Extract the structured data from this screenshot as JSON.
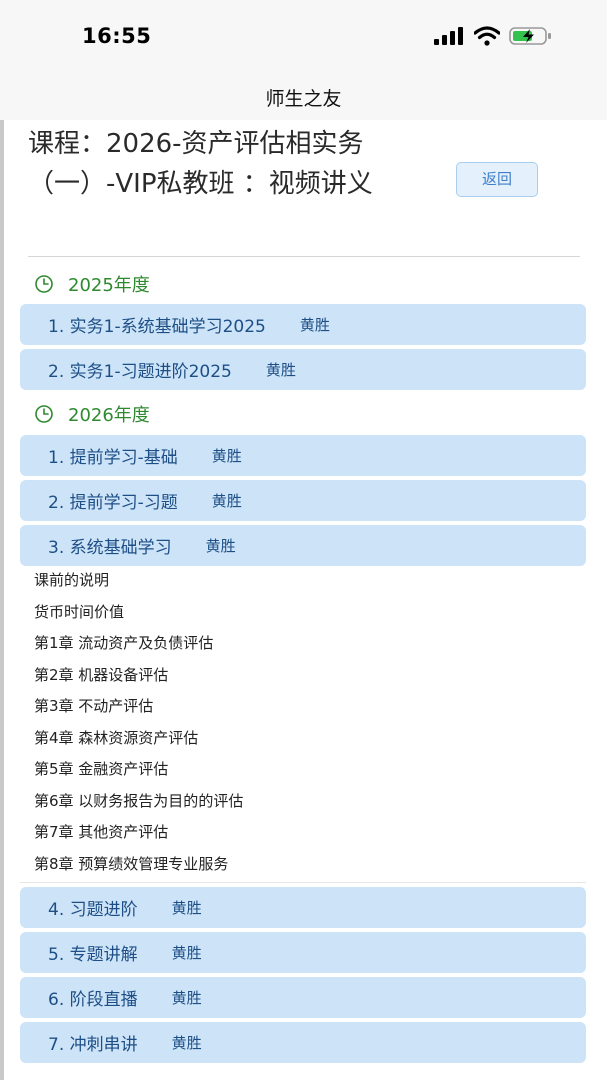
{
  "status_bar": {
    "time": "16:55",
    "battery": "charging"
  },
  "nav": {
    "title": "师生之友"
  },
  "course": {
    "title": "课程：2026-资产评估相实务（一）-VIP私教班 ：视频讲义",
    "back_label": "返回"
  },
  "years": [
    {
      "label": "2025年度",
      "sections": [
        {
          "title": "1. 实务1-系统基础学习2025",
          "teacher": "黄胜"
        },
        {
          "title": "2. 实务1-习题进阶2025",
          "teacher": "黄胜"
        }
      ]
    },
    {
      "label": "2026年度",
      "sections": [
        {
          "title": "1. 提前学习-基础",
          "teacher": "黄胜"
        },
        {
          "title": "2. 提前学习-习题",
          "teacher": "黄胜"
        },
        {
          "title": "3. 系统基础学习",
          "teacher": "黄胜",
          "lessons": [
            "课前的说明",
            "货币时间价值",
            "第1章 流动资产及负债评估",
            "第2章 机器设备评估",
            "第3章 不动产评估",
            "第4章 森林资源资产评估",
            "第5章 金融资产评估",
            "第6章 以财务报告为目的的评估",
            "第7章 其他资产评估",
            "第8章 预算绩效管理专业服务"
          ]
        },
        {
          "title": "4. 习题进阶",
          "teacher": "黄胜"
        },
        {
          "title": "5. 专题讲解",
          "teacher": "黄胜"
        },
        {
          "title": "6. 阶段直播",
          "teacher": "黄胜"
        },
        {
          "title": "7. 冲刺串讲",
          "teacher": "黄胜"
        }
      ]
    }
  ],
  "colors": {
    "accent": "#1d4f86",
    "row_bg": "#cde3f8",
    "year_green": "#2f8a2f"
  },
  "icons": [
    "signal-icon",
    "wifi-icon",
    "battery-charging-icon",
    "clock-icon"
  ]
}
